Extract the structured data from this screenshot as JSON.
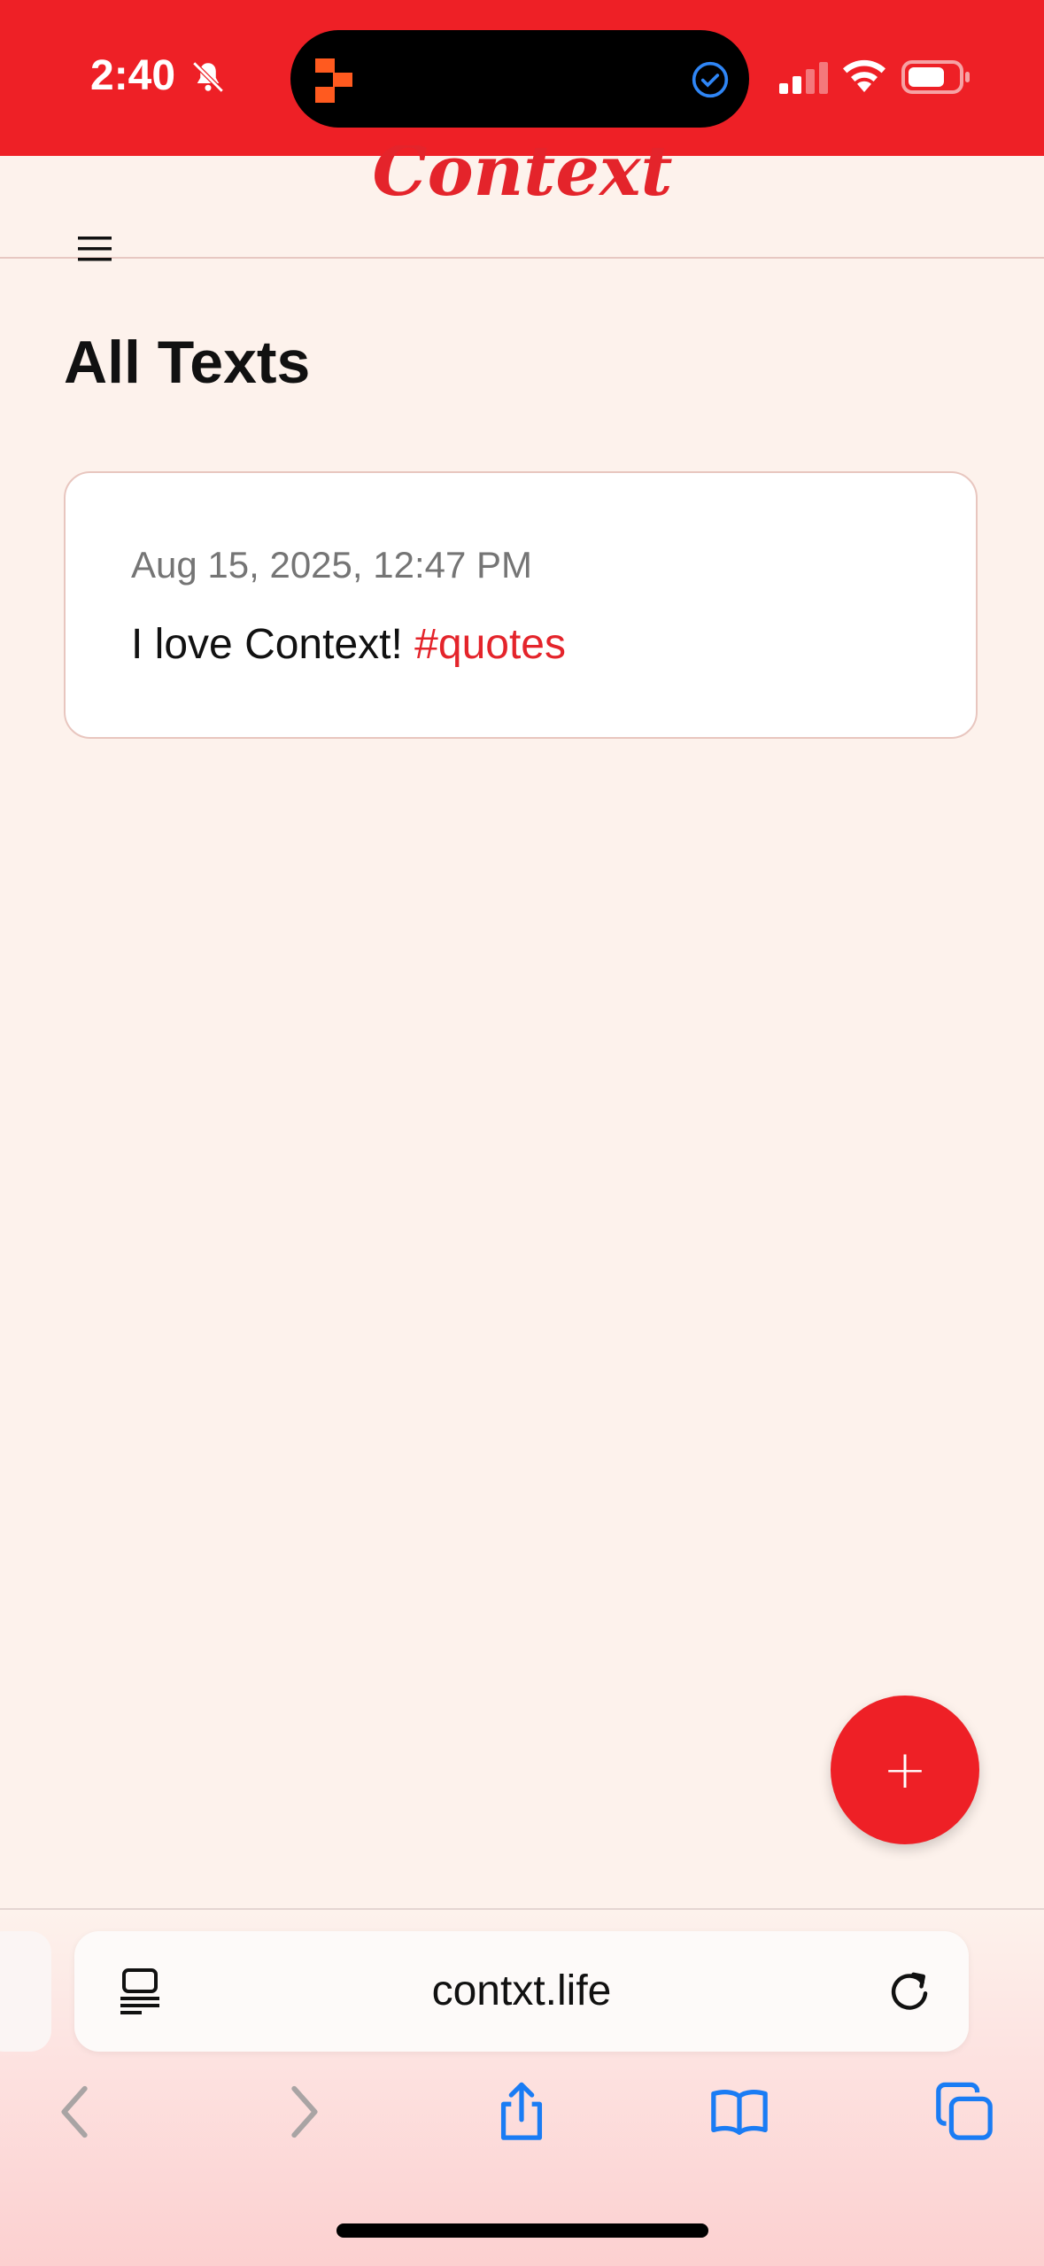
{
  "status_bar": {
    "time": "2:40",
    "icons": [
      "bell-slash-icon",
      "app-activity-icon",
      "check-circle-icon",
      "signal-icon",
      "wifi-icon",
      "battery-icon"
    ]
  },
  "header": {
    "logo_text": "Context",
    "menu_icon": "hamburger-menu-icon"
  },
  "page": {
    "title": "All Texts"
  },
  "texts": [
    {
      "date": "Aug 15, 2025, 12:47 PM",
      "body": "I love Context!",
      "tag": "#quotes"
    }
  ],
  "fab": {
    "label": "+"
  },
  "browser": {
    "url": "contxt.life",
    "toolbar": [
      "back-icon",
      "forward-icon",
      "share-icon",
      "bookmarks-icon",
      "tabs-icon"
    ]
  },
  "colors": {
    "brand_red": "#ee2026",
    "background": "#fdf2ec",
    "tag_red": "#e4242b",
    "ios_blue": "#1a7cf4"
  }
}
